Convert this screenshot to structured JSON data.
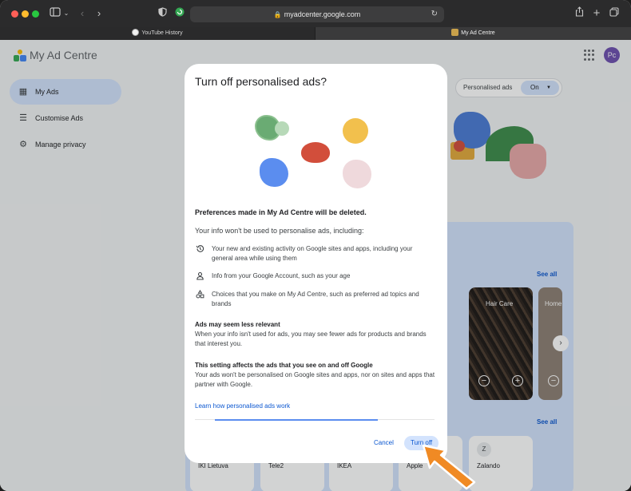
{
  "browser": {
    "address": "myadcenter.google.com",
    "tabs": [
      {
        "label": "YouTube History"
      },
      {
        "label": "My Ad Centre"
      }
    ]
  },
  "app": {
    "title": "My Ad Centre",
    "avatar_initials": "Pc",
    "nav": [
      {
        "label": "My Ads",
        "icon": "ads-icon",
        "active": true
      },
      {
        "label": "Customise Ads",
        "icon": "tune-icon",
        "active": false
      },
      {
        "label": "Manage privacy",
        "icon": "privacy-icon",
        "active": false
      }
    ],
    "toggle": {
      "label": "Personalised ads",
      "value": "On"
    },
    "see_all": "See all",
    "categories": [
      {
        "label": "Hair Care"
      },
      {
        "label": "Home"
      }
    ],
    "advertisers": [
      {
        "name": "IKI Lietuva"
      },
      {
        "name": "Tele2"
      },
      {
        "name": "IKEA"
      },
      {
        "name": "Apple"
      },
      {
        "name": "Zalando",
        "letter": "Z"
      }
    ]
  },
  "dialog": {
    "title": "Turn off personalised ads?",
    "deleted_notice": "Preferences made in My Ad Centre will be deleted.",
    "info_intro": "Your info won't be used to personalise ads, including:",
    "items": [
      {
        "icon": "history-icon",
        "text": "Your new and existing activity on Google sites and apps, including your general area while using them"
      },
      {
        "icon": "person-icon",
        "text": "Info from your Google Account, such as your age"
      },
      {
        "icon": "shapes-icon",
        "text": "Choices that you make on My Ad Centre, such as preferred ad topics and brands"
      }
    ],
    "relevant_heading": "Ads may seem less relevant",
    "relevant_body": "When your info isn't used for ads, you may see fewer ads for products and brands that interest you.",
    "setting_heading": "This setting affects the ads that you see on and off Google",
    "setting_body": "Your ads won't be personalised on Google sites and apps, nor on sites and apps that partner with Google.",
    "learn_link": "Learn how personalised ads work",
    "cancel": "Cancel",
    "turn_off": "Turn off"
  },
  "colors": {
    "accent": "#0b57d0",
    "selected": "#d3e3fd",
    "annotation": "#f08a24"
  }
}
